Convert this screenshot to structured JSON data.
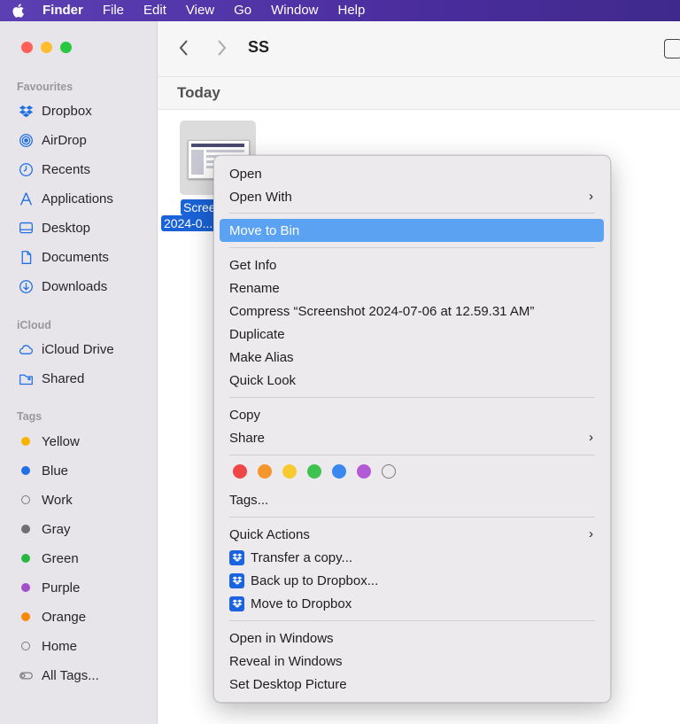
{
  "menubar": {
    "app": "Finder",
    "items": [
      "File",
      "Edit",
      "View",
      "Go",
      "Window",
      "Help"
    ]
  },
  "sidebar": {
    "favourites_title": "Favourites",
    "favourites": [
      {
        "label": "Dropbox",
        "icon": "dropbox-icon"
      },
      {
        "label": "AirDrop",
        "icon": "airdrop-icon"
      },
      {
        "label": "Recents",
        "icon": "clock-icon"
      },
      {
        "label": "Applications",
        "icon": "applications-icon"
      },
      {
        "label": "Desktop",
        "icon": "desktop-icon"
      },
      {
        "label": "Documents",
        "icon": "document-icon"
      },
      {
        "label": "Downloads",
        "icon": "download-icon"
      }
    ],
    "icloud_title": "iCloud",
    "icloud": [
      {
        "label": "iCloud Drive",
        "icon": "cloud-icon"
      },
      {
        "label": "Shared",
        "icon": "shared-folder-icon"
      }
    ],
    "tags_title": "Tags",
    "tags": [
      {
        "label": "Yellow",
        "color": "#f5b400"
      },
      {
        "label": "Blue",
        "color": "#1f6fe6"
      },
      {
        "label": "Work",
        "color": ""
      },
      {
        "label": "Gray",
        "color": "#6f6e73"
      },
      {
        "label": "Green",
        "color": "#27b843"
      },
      {
        "label": "Purple",
        "color": "#a24fc9"
      },
      {
        "label": "Orange",
        "color": "#f58a0b"
      },
      {
        "label": "Home",
        "color": ""
      },
      {
        "label": "All Tags...",
        "color": "all"
      }
    ]
  },
  "toolbar": {
    "back": "‹",
    "forward": "›",
    "title": "SS"
  },
  "group_title": "Today",
  "file": {
    "label_line1": "Scree",
    "label_line2": "2024-0..."
  },
  "context_menu": {
    "open": "Open",
    "open_with": "Open With",
    "move_to_bin": "Move to Bin",
    "get_info": "Get Info",
    "rename": "Rename",
    "compress": "Compress “Screenshot 2024-07-06 at 12.59.31 AM”",
    "duplicate": "Duplicate",
    "make_alias": "Make Alias",
    "quick_look": "Quick Look",
    "copy": "Copy",
    "share": "Share",
    "tag_colors": [
      "#f04545",
      "#f5962d",
      "#f7cb2f",
      "#3fc350",
      "#3a87f0",
      "#b35ad6",
      "hollow"
    ],
    "tags": "Tags...",
    "quick_actions": "Quick Actions",
    "transfer_copy": "Transfer a copy...",
    "back_up_dropbox": "Back up to Dropbox...",
    "move_to_dropbox": "Move to Dropbox",
    "open_in_windows": "Open in Windows",
    "reveal_in_windows": "Reveal in Windows",
    "set_desktop_picture": "Set Desktop Picture",
    "chevron": "›"
  }
}
